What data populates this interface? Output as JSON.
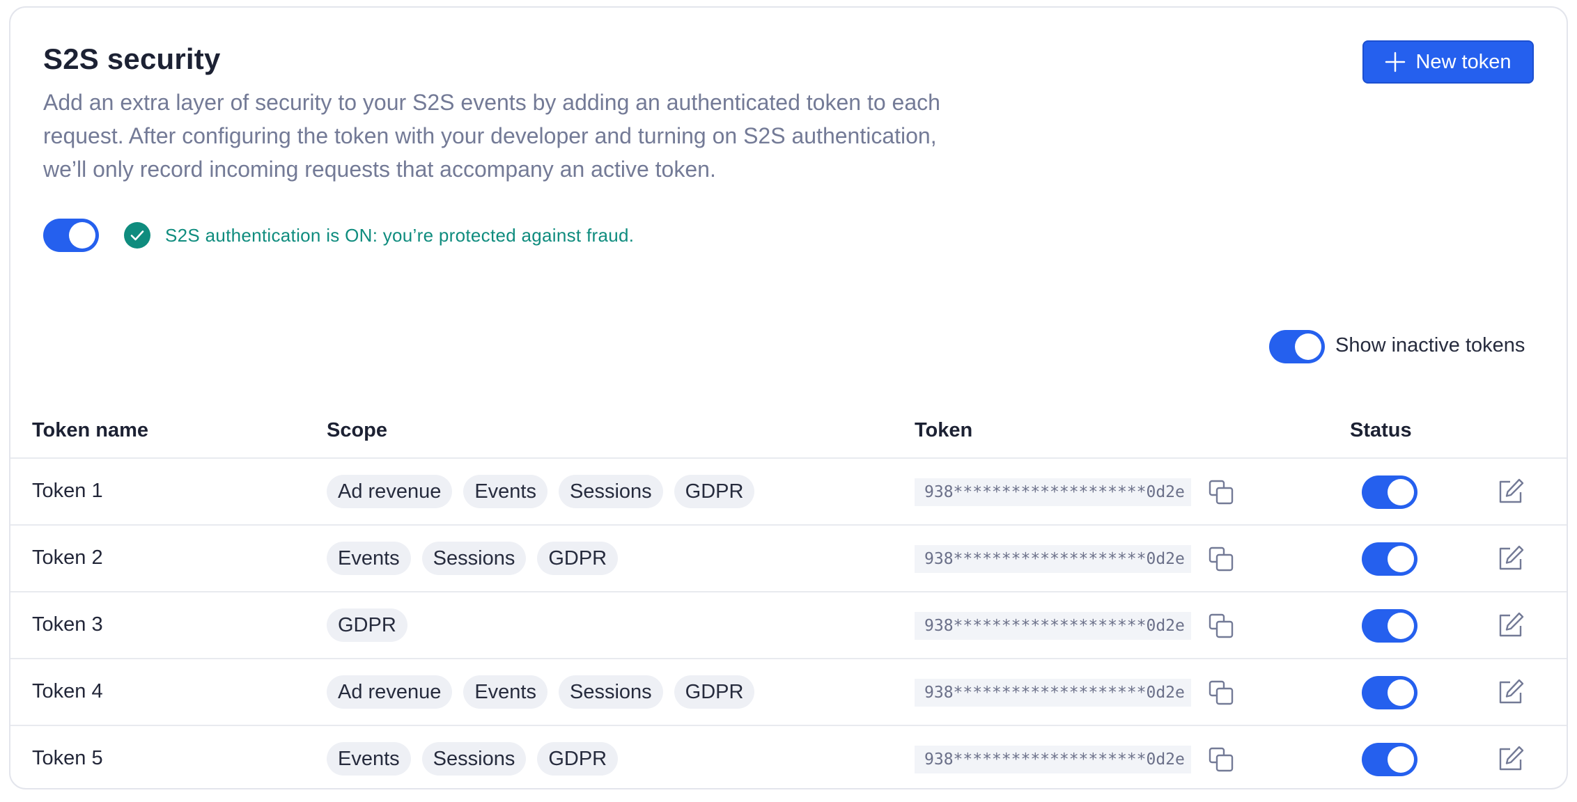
{
  "header": {
    "title": "S2S security",
    "description": "Add an extra layer of security to your S2S events by adding an authenticated token to each request. After configuring the token with your developer and turning on S2S authentication, we’ll only record incoming requests that accompany an active token.",
    "new_token_label": "New token"
  },
  "auth": {
    "enabled": true,
    "status_text": "S2S authentication is ON: you’re protected against fraud.",
    "status_color": "#0f8c7e"
  },
  "filters": {
    "show_inactive_label": "Show inactive tokens",
    "show_inactive": true
  },
  "table": {
    "columns": {
      "name": "Token name",
      "scope": "Scope",
      "token": "Token",
      "status": "Status"
    },
    "rows": [
      {
        "name": "Token 1",
        "scopes": [
          "Ad revenue",
          "Events",
          "Sessions",
          "GDPR"
        ],
        "token": "938********************0d2e",
        "active": true
      },
      {
        "name": "Token 2",
        "scopes": [
          "Events",
          "Sessions",
          "GDPR"
        ],
        "token": "938********************0d2e",
        "active": true
      },
      {
        "name": "Token 3",
        "scopes": [
          "GDPR"
        ],
        "token": "938********************0d2e",
        "active": true
      },
      {
        "name": "Token 4",
        "scopes": [
          "Ad revenue",
          "Events",
          "Sessions",
          "GDPR"
        ],
        "token": "938********************0d2e",
        "active": true
      },
      {
        "name": "Token 5",
        "scopes": [
          "Events",
          "Sessions",
          "GDPR"
        ],
        "token": "938********************0d2e",
        "active": true
      }
    ]
  },
  "icons": {
    "new_token": "plus-icon",
    "auth_status": "check-circle-icon",
    "copy": "copy-icon",
    "edit": "edit-icon"
  },
  "colors": {
    "accent": "#2560ee",
    "success": "#0f8c7e"
  }
}
